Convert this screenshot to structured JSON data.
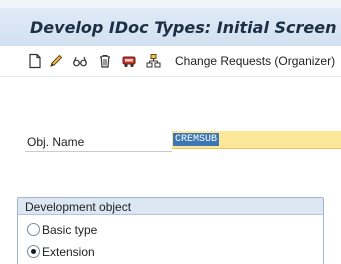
{
  "window": {
    "title": "Develop IDoc Types: Initial Screen"
  },
  "toolbar": {
    "icons": [
      "create-icon",
      "change-icon",
      "display-icon",
      "delete-icon",
      "transport-icon",
      "where-used-icon"
    ],
    "change_requests_label": "Change Requests (Organizer)"
  },
  "form": {
    "obj_name_label": "Obj. Name",
    "obj_name_value": "CREMSUB"
  },
  "development_object": {
    "title": "Development object",
    "options": [
      {
        "label": "Basic type",
        "selected": false
      },
      {
        "label": "Extension",
        "selected": true
      }
    ]
  }
}
